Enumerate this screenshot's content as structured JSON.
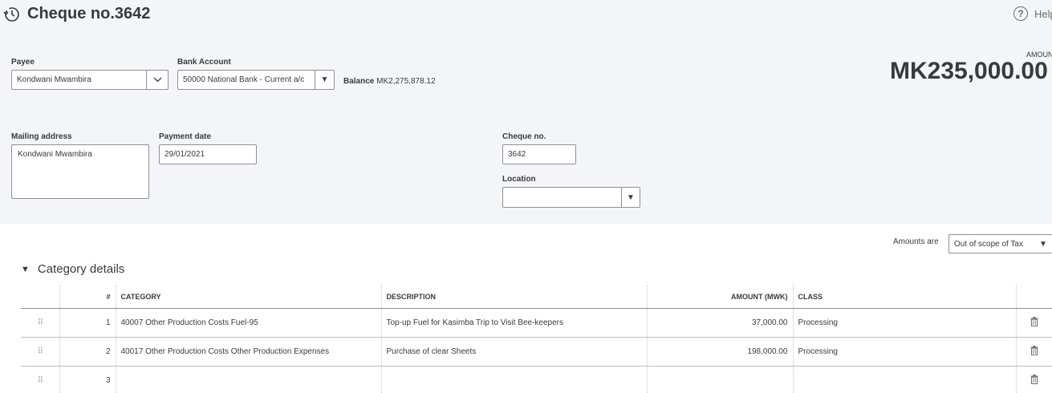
{
  "header": {
    "title": "Cheque no.3642",
    "help_label": "Help",
    "help_glyph": "?"
  },
  "payee": {
    "label": "Payee",
    "value": "Kondwani Mwambira"
  },
  "bank_account": {
    "label": "Bank Account",
    "value": "50000 National Bank - Current a/c",
    "balance_label": "Balance",
    "balance_value": "MK2,275,878.12"
  },
  "amount": {
    "label": "AMOUNT",
    "value": "MK235,000.00"
  },
  "mailing_address": {
    "label": "Mailing address",
    "value": "Kondwani Mwambira"
  },
  "payment_date": {
    "label": "Payment date",
    "value": "29/01/2021"
  },
  "cheque_no": {
    "label": "Cheque no.",
    "value": "3642"
  },
  "location": {
    "label": "Location",
    "value": ""
  },
  "tax": {
    "label": "Amounts are",
    "value": "Out of scope of Tax"
  },
  "category_details": {
    "title": "Category details",
    "columns": {
      "num": "#",
      "category": "CATEGORY",
      "description": "DESCRIPTION",
      "amount": "AMOUNT (MWK)",
      "class": "CLASS"
    },
    "rows": [
      {
        "num": "1",
        "category": "40007 Other Production Costs Fuel-95",
        "description": "Top-up Fuel for Kasimba Trip to Visit Bee-keepers",
        "amount": "37,000.00",
        "class": "Processing"
      },
      {
        "num": "2",
        "category": "40017 Other Production Costs Other Production Expenses",
        "description": "Purchase of clear Sheets",
        "amount": "198,000.00",
        "class": "Processing"
      },
      {
        "num": "3",
        "category": "",
        "description": "",
        "amount": "",
        "class": ""
      }
    ]
  },
  "icons": {
    "history": "history-icon",
    "help": "help-icon",
    "chevron": "chevron-down-icon",
    "dropdown": "caret-down-icon",
    "drag": "drag-handle-icon",
    "trash": "trash-icon"
  }
}
